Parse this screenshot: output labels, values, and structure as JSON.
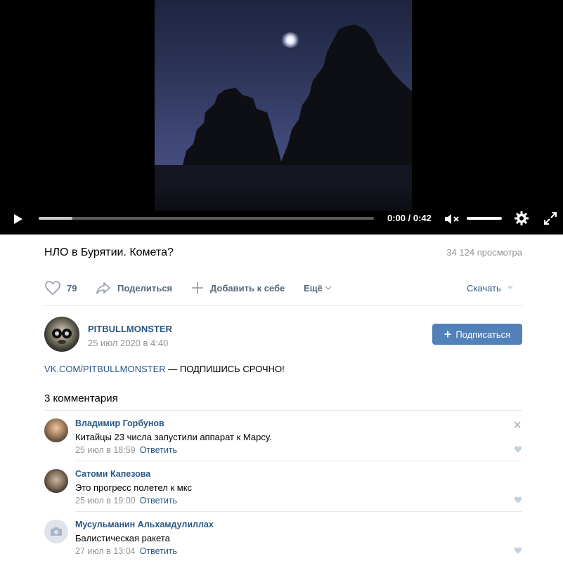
{
  "player": {
    "time": "0:00 / 0:42",
    "buffered_fraction": 0.1
  },
  "video": {
    "title": "НЛО в Бурятии. Комета?",
    "views": "34 124 просмотра"
  },
  "actions": {
    "like_count": "79",
    "share_label": "Поделиться",
    "add_label": "Добавить к себе",
    "more_label": "Ещё",
    "download_label": "Скачать"
  },
  "author": {
    "name": "PITBULLMONSTER",
    "date": "25 июл 2020 в 4:40",
    "subscribe_label": "Подписаться"
  },
  "description": {
    "link": "VK.COM/PITBULLMONSTER",
    "text": " — ПОДПИШИСЬ СРОЧНО!"
  },
  "comments": {
    "title": "3 комментария",
    "items": [
      {
        "name": "Владимир Горбунов",
        "text": "Китайцы 23 числа запустили аппарат к Марсу.",
        "date": "25 июл в 18:59",
        "reply": "Ответить"
      },
      {
        "name": "Сатоми Капезова",
        "text": "Это прогресс полетел к мкс",
        "date": "25 июл в 19:00",
        "reply": "Ответить"
      },
      {
        "name": "Мусульманин Альхамдулиллах",
        "text": "Балистическая ракета",
        "date": "27 июл в 13:04",
        "reply": "Ответить"
      }
    ]
  },
  "colors": {
    "link": "#2a5885",
    "button": "#5181b8",
    "muted": "#939393"
  }
}
